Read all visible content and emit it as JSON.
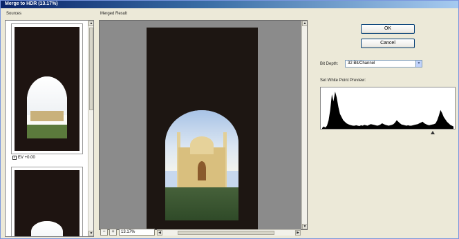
{
  "window": {
    "title": "Merge to HDR (13.17%)"
  },
  "sources": {
    "label": "Sources",
    "items": [
      {
        "caption": "EV +0.00",
        "checked": true
      },
      {
        "caption": "",
        "checked": false
      }
    ]
  },
  "merged": {
    "label": "Merged Result",
    "zoom_value": "13.17%",
    "zoom_out": "−",
    "zoom_in": "+"
  },
  "controls": {
    "ok_label": "OK",
    "cancel_label": "Cancel",
    "bit_depth_label": "Bit Depth:",
    "bit_depth_value": "32 Bit/Channel",
    "white_point_label": "Set White Point Preview:"
  },
  "histogram": {
    "bins": [
      2,
      6,
      3,
      8,
      22,
      48,
      88,
      70,
      95,
      80,
      56,
      38,
      30,
      22,
      18,
      14,
      12,
      10,
      9,
      8,
      8,
      9,
      8,
      7,
      9,
      8,
      10,
      9,
      8,
      10,
      12,
      11,
      10,
      9,
      8,
      9,
      11,
      14,
      12,
      10,
      9,
      8,
      9,
      10,
      12,
      16,
      22,
      18,
      14,
      11,
      10,
      9,
      8,
      9,
      8,
      8,
      9,
      10,
      11,
      12,
      14,
      16,
      18,
      14,
      12,
      10,
      9,
      10,
      11,
      12,
      14,
      22,
      34,
      48,
      40,
      30,
      24,
      18,
      14,
      10,
      8,
      6
    ],
    "white_point_position": 0.83,
    "fill_color": "#000000"
  },
  "colors": {
    "titlebar": "#0a246a",
    "preview_backdrop": "#8b8b8b",
    "dark_frame": "#1d1612"
  }
}
